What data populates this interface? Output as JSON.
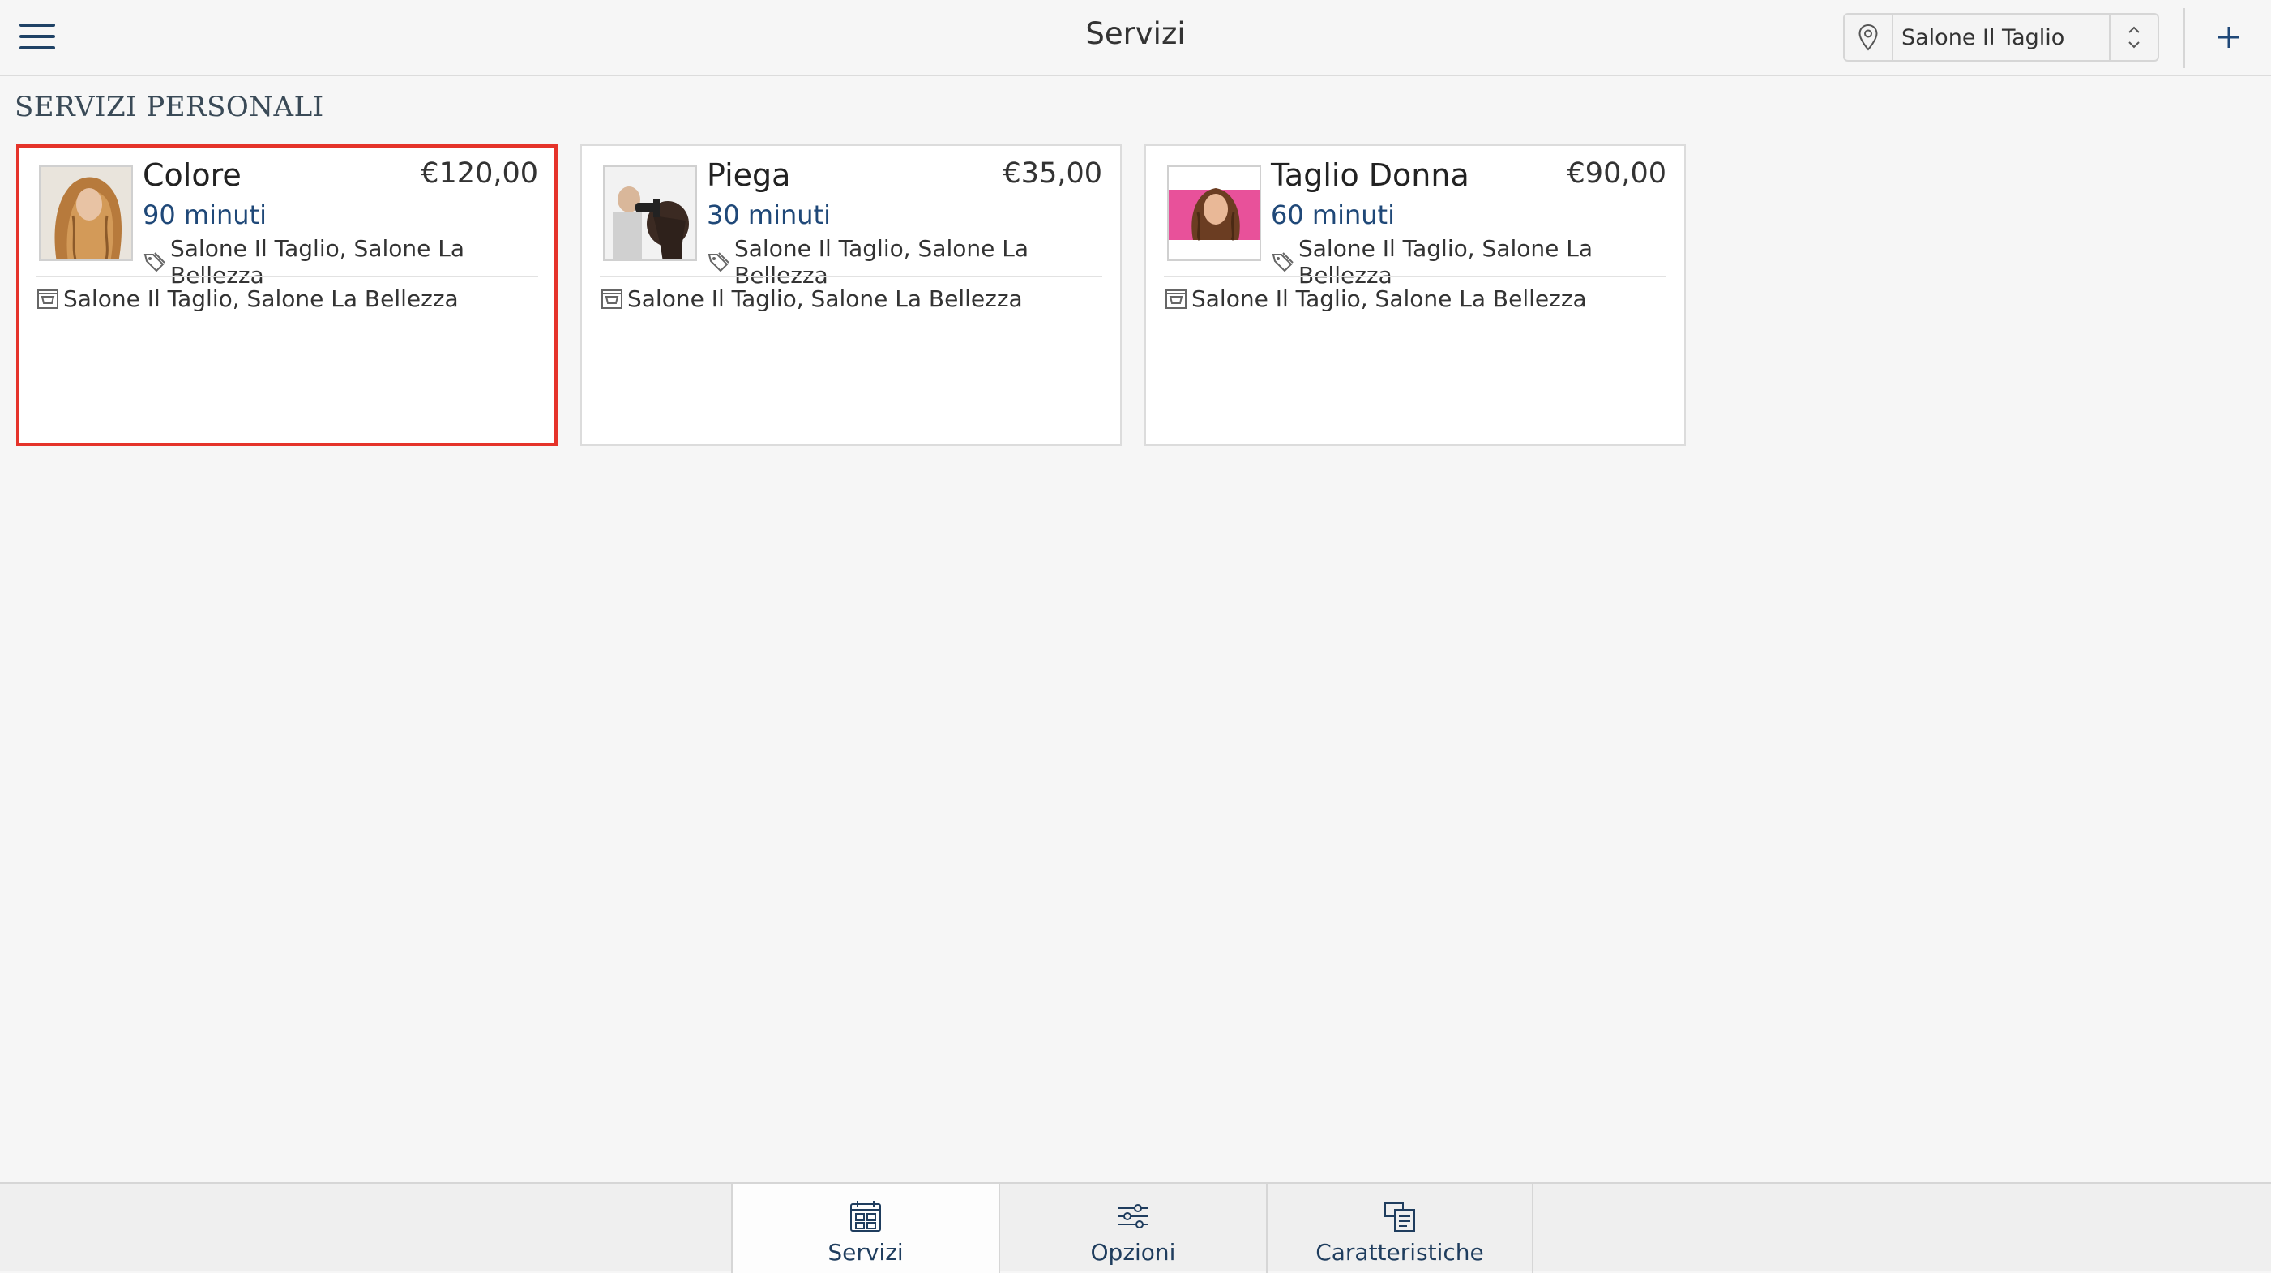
{
  "header": {
    "title": "Servizi",
    "location_value": "Salone Il Taglio",
    "menu_icon": "hamburger-menu-icon",
    "location_icon": "map-pin-icon",
    "add_icon": "plus-icon"
  },
  "section": {
    "title": "SERVIZI PERSONALI"
  },
  "services": [
    {
      "name": "Colore",
      "price": "€120,00",
      "duration": "90 minuti",
      "tags": "Salone Il Taglio, Salone La Bellezza",
      "stores": "Salone Il Taglio, Salone La Bellezza",
      "selected": true
    },
    {
      "name": "Piega",
      "price": "€35,00",
      "duration": "30 minuti",
      "tags": "Salone Il Taglio, Salone La Bellezza",
      "stores": "Salone Il Taglio, Salone La Bellezza",
      "selected": false
    },
    {
      "name": "Taglio Donna",
      "price": "€90,00",
      "duration": "60 minuti",
      "tags": "Salone Il Taglio, Salone La Bellezza",
      "stores": "Salone Il Taglio, Salone La Bellezza",
      "selected": false
    }
  ],
  "tabs": [
    {
      "label": "Servizi",
      "icon": "grid-calendar-icon",
      "active": true
    },
    {
      "label": "Opzioni",
      "icon": "sliders-icon",
      "active": false
    },
    {
      "label": "Caratteristiche",
      "icon": "features-icon",
      "active": false
    }
  ],
  "colors": {
    "accent": "#1f4878",
    "selection": "#e5332a",
    "background": "#f6f6f6"
  }
}
